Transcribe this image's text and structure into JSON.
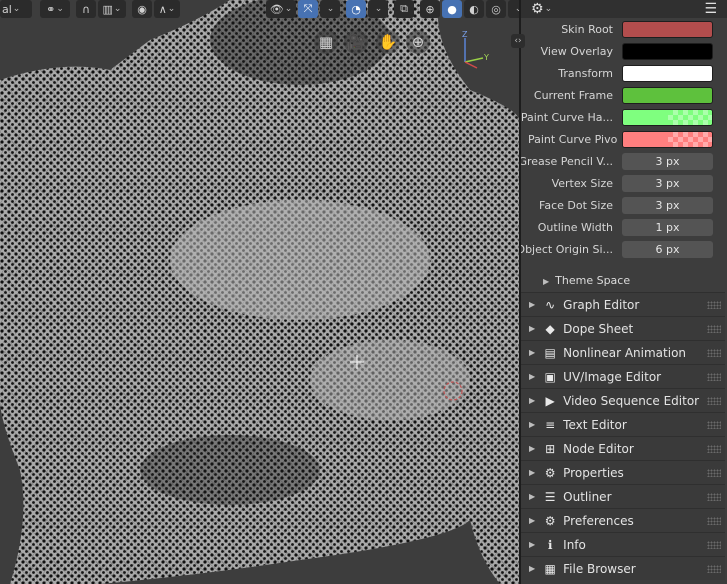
{
  "viewport": {
    "toolbar_left_text": "al",
    "toolbar_icons": [
      "pivot-icon",
      "snap-icon",
      "proportional-edit-icon",
      "falloff-icon"
    ],
    "header_icons": [
      "visibility-icon",
      "gizmo-icon",
      "overlay-icon",
      "xray-icon",
      "wireframe-shading-icon",
      "solid-shading-icon",
      "material-shading-icon",
      "rendered-shading-icon"
    ],
    "nav_gizmos": [
      "grid-icon",
      "camera-icon",
      "hand-icon",
      "zoom-icon"
    ],
    "axis_labels": {
      "y": "Y",
      "z": "Z"
    }
  },
  "panel": {
    "header_icons": [
      "gear-icon",
      "hamburger-icon"
    ],
    "color_props": [
      {
        "label": "Skin Root",
        "color": "#b34d4d",
        "alpha": false
      },
      {
        "label": "View Overlay",
        "color": "#000000",
        "alpha": false
      },
      {
        "label": "Transform",
        "color": "#ffffff",
        "alpha": false
      },
      {
        "label": "Current Frame",
        "color": "#5ec13d",
        "alpha": false
      },
      {
        "label": "Paint Curve Ha...",
        "color": "#7fff7f",
        "alpha": true
      },
      {
        "label": "Paint Curve Pivo",
        "color": "#ff7f7f",
        "alpha": true
      }
    ],
    "num_props": [
      {
        "label": "Grease Pencil V...",
        "value": "3 px"
      },
      {
        "label": "Vertex Size",
        "value": "3 px"
      },
      {
        "label": "Face Dot Size",
        "value": "3 px"
      },
      {
        "label": "Outline Width",
        "value": "1 px"
      },
      {
        "label": "Object Origin Si...",
        "value": "6 px"
      }
    ],
    "sub_section": "Theme Space",
    "editors": [
      {
        "label": "Graph Editor",
        "icon": "graph-editor-icon",
        "glyph": "∿"
      },
      {
        "label": "Dope Sheet",
        "icon": "dope-sheet-icon",
        "glyph": "◆"
      },
      {
        "label": "Nonlinear Animation",
        "icon": "nla-icon",
        "glyph": "▤"
      },
      {
        "label": "UV/Image Editor",
        "icon": "image-editor-icon",
        "glyph": "▣"
      },
      {
        "label": "Video Sequence Editor",
        "icon": "sequencer-icon",
        "glyph": "▶"
      },
      {
        "label": "Text Editor",
        "icon": "text-editor-icon",
        "glyph": "≡"
      },
      {
        "label": "Node Editor",
        "icon": "node-editor-icon",
        "glyph": "⊞"
      },
      {
        "label": "Properties",
        "icon": "properties-icon",
        "glyph": "⚙"
      },
      {
        "label": "Outliner",
        "icon": "outliner-icon",
        "glyph": "☰"
      },
      {
        "label": "Preferences",
        "icon": "preferences-icon",
        "glyph": "⚙"
      },
      {
        "label": "Info",
        "icon": "info-icon",
        "glyph": "ℹ"
      },
      {
        "label": "File Browser",
        "icon": "file-browser-icon",
        "glyph": "▦"
      }
    ]
  }
}
